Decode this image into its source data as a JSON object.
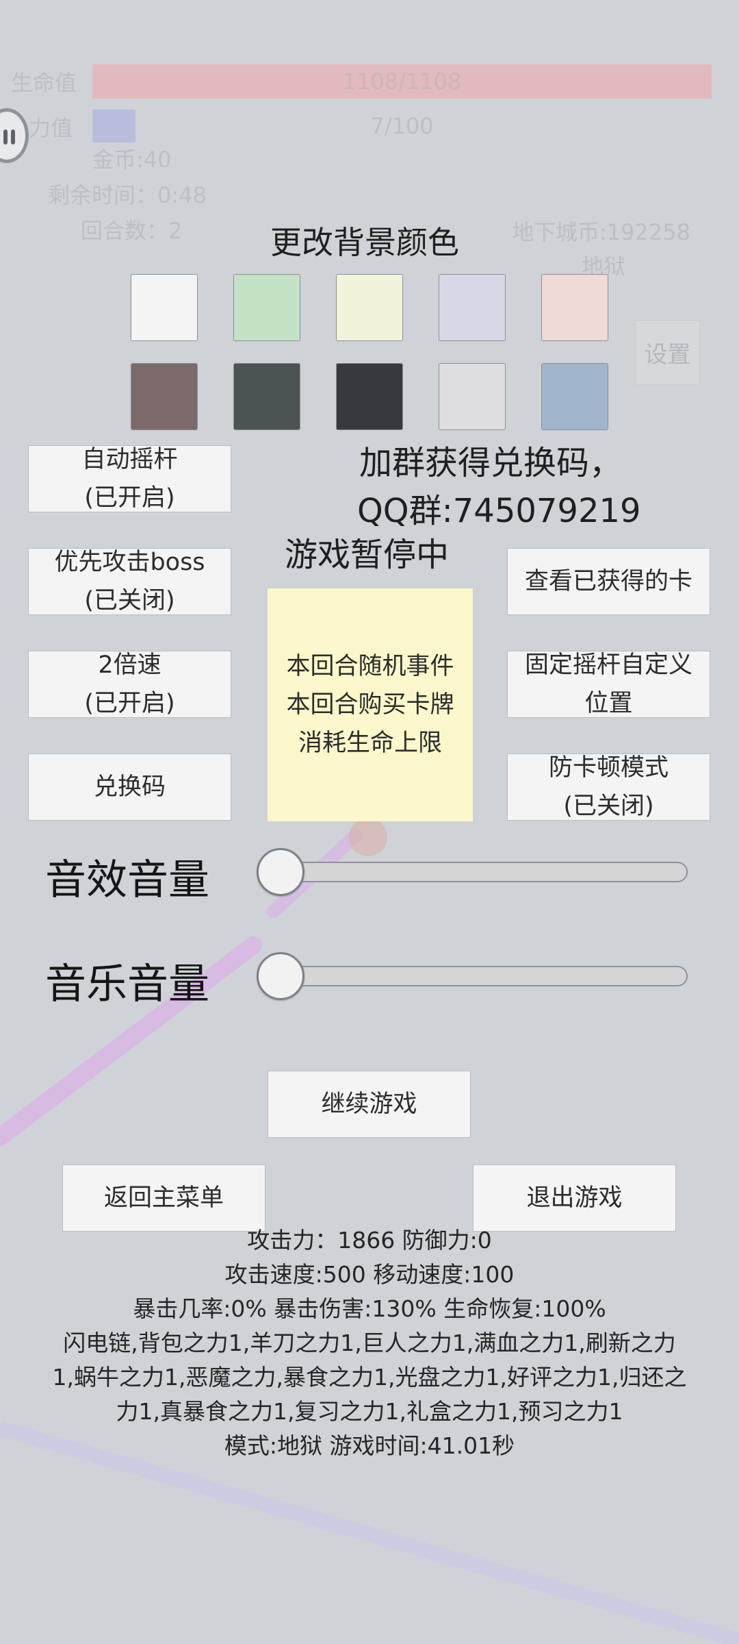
{
  "hud": {
    "hp_label": "生命值",
    "hp_text": "1108/1108",
    "hp_fraction": 1.0,
    "energy_label": "力值",
    "energy_text": "7/100",
    "energy_fraction": 0.07,
    "gold": "金币:40",
    "time_left": "剩余时间：0:48",
    "round": "回合数：2",
    "dungeon_coin": "地下城币:192258",
    "difficulty": "地狱",
    "settings_label": "设置"
  },
  "background": {
    "title": "更改背景颜色",
    "swatches": [
      "#f4f4f4",
      "#c4e2c5",
      "#f1f3da",
      "#d6d8e7",
      "#efdad6",
      "#7b6a69",
      "#4b5354",
      "#38393f",
      "#dddde2",
      "#a0b6cc"
    ]
  },
  "promo": {
    "line1": "加群获得兑换码，",
    "line2": "QQ群:745079219"
  },
  "paused_text": "游戏暂停中",
  "left_buttons": [
    {
      "line1": "自动摇杆",
      "line2": "(已开启)"
    },
    {
      "line1": "优先攻击boss",
      "line2": "(已关闭)"
    },
    {
      "line1": "2倍速",
      "line2": "(已开启)"
    },
    {
      "line1": "兑换码",
      "line2": ""
    }
  ],
  "right_buttons": [
    {
      "line1": "查看已获得的卡",
      "line2": ""
    },
    {
      "line1": "固定摇杆自定义",
      "line2": "位置"
    },
    {
      "line1": "防卡顿模式",
      "line2": "(已关闭)"
    }
  ],
  "event_notice": {
    "line1": "本回合随机事件",
    "line2": "本回合购买卡牌",
    "line3": "消耗生命上限"
  },
  "volume": {
    "sfx_label": "音效音量",
    "sfx_level": 0,
    "music_label": "音乐音量",
    "music_level": 0
  },
  "actions": {
    "continue": "继续游戏",
    "main_menu": "返回主菜单",
    "quit": "退出游戏"
  },
  "stats": {
    "line1": "攻击力：1866 防御力:0",
    "line2": "攻击速度:500 移动速度:100",
    "line3": "暴击几率:0% 暴击伤害:130% 生命恢复:100%",
    "line4": "闪电链,背包之力1,羊刀之力1,巨人之力1,满血之力1,刷新之力",
    "line5": "1,蜗牛之力1,恶魔之力,暴食之力1,光盘之力1,好评之力1,归还之",
    "line6": "力1,真暴食之力1,复习之力1,礼盒之力1,预习之力1",
    "line7": "模式:地狱 游戏时间:41.01秒"
  }
}
